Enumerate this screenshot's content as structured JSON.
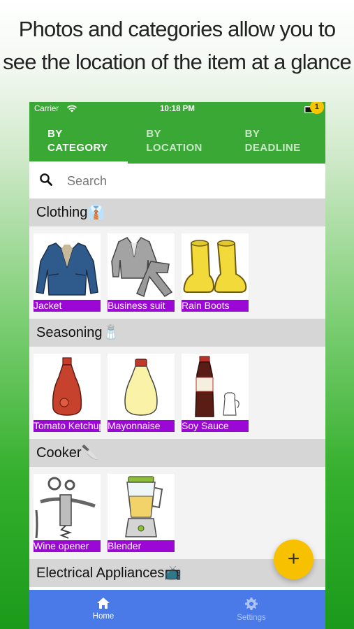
{
  "headline": {
    "line1": "Photos and categories allow you to",
    "line2": "see the location of the item at a glance"
  },
  "status_bar": {
    "carrier": "Carrier",
    "time": "10:18 PM"
  },
  "tabs": [
    {
      "line1": "BY",
      "line2": "CATEGORY",
      "active": true
    },
    {
      "line1": "BY",
      "line2": "LOCATION",
      "active": false
    },
    {
      "line1": "BY",
      "line2": "DEADLINE",
      "active": false,
      "badge": "1"
    }
  ],
  "search": {
    "placeholder": "Search",
    "icon": "search-icon"
  },
  "sections": [
    {
      "title": "Clothing👔",
      "items": [
        "Jacket",
        "Business suit",
        "Rain Boots"
      ]
    },
    {
      "title": "Seasoning🧂",
      "items": [
        "Tomato Ketchup",
        "Mayonnaise",
        "Soy Sauce"
      ]
    },
    {
      "title": "Cooker🔪",
      "items": [
        "Wine opener",
        "Blender"
      ]
    },
    {
      "title": "Electrical Appliances📺",
      "items": []
    }
  ],
  "bottom_nav": {
    "home_label": "Home",
    "settings_label": "Settings"
  },
  "fab": {
    "label": "+"
  },
  "colors": {
    "header_green": "#3aa835",
    "label_purple": "#9b07d5",
    "nav_blue": "#4a7ae8",
    "fab_yellow": "#f7c100"
  }
}
